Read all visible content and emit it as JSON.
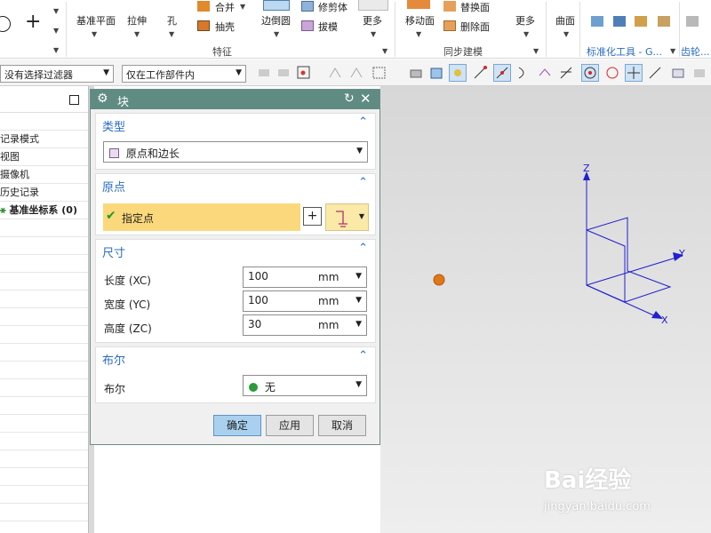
{
  "ribbon": {
    "datum_plane": "基准平面",
    "extrude": "拉伸",
    "hole": "孔",
    "unite": "合并",
    "shell": "抽壳",
    "edge_blend": "边倒圆",
    "trim_body": "修剪体",
    "draft": "拔模",
    "more1": "更多",
    "feature_group": "特征",
    "move_face": "移动面",
    "replace_face": "替换面",
    "delete_face": "删除面",
    "more2": "更多",
    "sync_group": "同步建模",
    "surface": "曲面",
    "std_tools_group": "标准化工具 - G...",
    "gear_group": "齿轮..."
  },
  "toolbar": {
    "filter_value": "没有选择过滤器",
    "scope_value": "仅在工作部件内"
  },
  "navigator": {
    "rows": [
      "记录模式",
      "视图",
      "摄像机",
      "历史记录",
      "基准坐标系 (0)"
    ]
  },
  "dialog": {
    "title": "块",
    "type_section": "类型",
    "type_value": "原点和边长",
    "origin_section": "原点",
    "specify_point": "指定点",
    "dimensions_section": "尺寸",
    "length_label": "长度 (XC)",
    "length_value": "100",
    "width_label": "宽度 (YC)",
    "width_value": "100",
    "height_label": "高度 (ZC)",
    "height_value": "30",
    "unit": "mm",
    "boolean_section": "布尔",
    "boolean_label": "布尔",
    "boolean_value": "无",
    "ok": "确定",
    "apply": "应用",
    "cancel": "取消"
  },
  "viewport": {
    "axis_z": "Z",
    "axis_y": "Y",
    "axis_x": "X",
    "axis_color": "#2020d0",
    "origin_marker_color": "#e07818"
  },
  "watermark": {
    "brand": "Bai经验",
    "url": "jingyan.baidu.com"
  }
}
